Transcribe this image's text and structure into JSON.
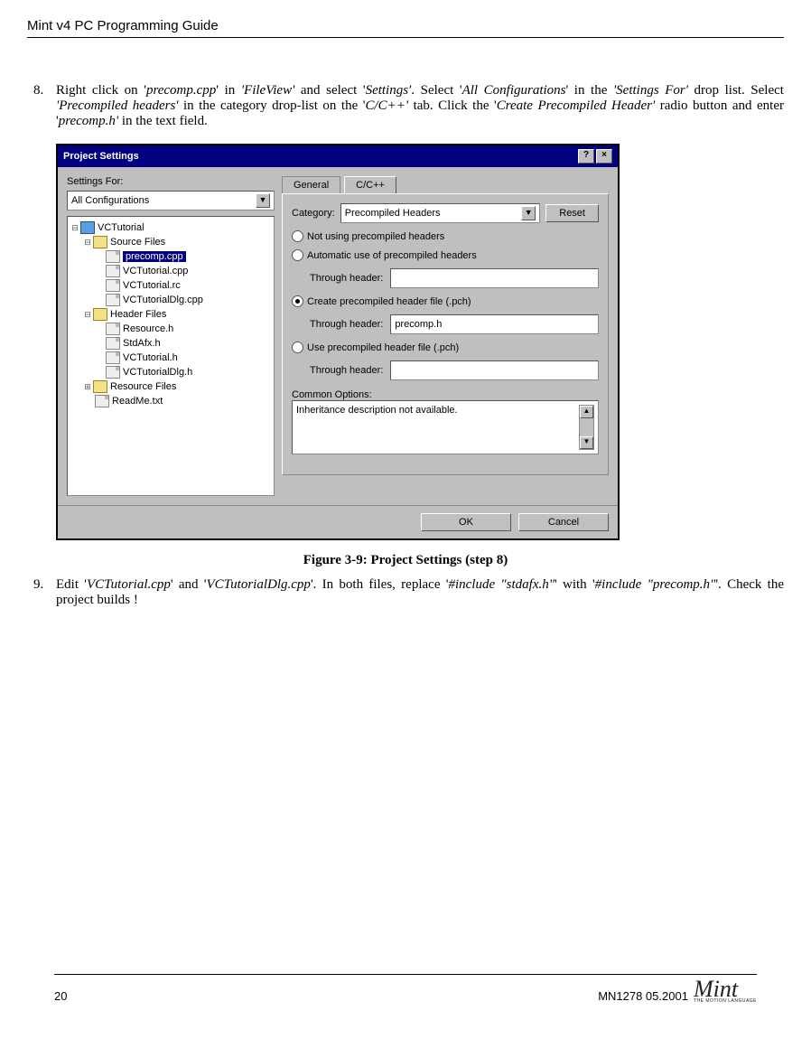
{
  "doc": {
    "header": "Mint v4 PC Programming Guide",
    "page_number": "20",
    "footer_code": "MN1278  05.2001",
    "logo_text": "Mint",
    "logo_sub": "THE MOTION LANGUAGE"
  },
  "steps": {
    "s8_num": "8",
    "s8_parts": [
      "Right click on '",
      "precomp.cpp",
      "' in ",
      "'FileView'",
      " and select '",
      "Settings'",
      ".  Select '",
      "All Configurations",
      "' in the ",
      "'Settings For'",
      " drop list.  Select ",
      "'Precompiled headers'",
      " in the category drop-list on the '",
      "C/C++'",
      " tab.  Click the '",
      "Create Precompiled Header'",
      " radio button and enter '",
      "precomp.h'",
      " in the text field."
    ],
    "s9_num": "9",
    "s9_parts": [
      "Edit '",
      "VCTutorial.cpp",
      "' and '",
      "VCTutorialDlg.cpp",
      "'.  In both files, replace '",
      "#include \"stdafx.h\"",
      "' with '",
      "#include \"precomp.h\"",
      "'.  Check the project builds !"
    ]
  },
  "figcap": "Figure 3-9: Project Settings (step 8)",
  "dlg": {
    "title": "Project Settings",
    "settings_for_label": "Settings For:",
    "settings_for_value": "All Configurations",
    "tabs": {
      "general": "General",
      "ccpp": "C/C++"
    },
    "category_label": "Category:",
    "category_value": "Precompiled Headers",
    "reset": "Reset",
    "opt_not": "Not using precompiled headers",
    "opt_auto": "Automatic use of precompiled headers",
    "opt_create": "Create precompiled header file (.pch)",
    "opt_use": "Use precompiled header file (.pch)",
    "through": "Through header:",
    "through_val": "precomp.h",
    "common_label": "Common Options:",
    "common_text": "Inheritance description not available.",
    "ok": "OK",
    "cancel": "Cancel",
    "tree": {
      "root": "VCTutorial",
      "src": "Source Files",
      "src_items": [
        "precomp.cpp",
        "VCTutorial.cpp",
        "VCTutorial.rc",
        "VCTutorialDlg.cpp"
      ],
      "hdr": "Header Files",
      "hdr_items": [
        "Resource.h",
        "StdAfx.h",
        "VCTutorial.h",
        "VCTutorialDlg.h"
      ],
      "res": "Resource Files",
      "readme": "ReadMe.txt"
    }
  }
}
